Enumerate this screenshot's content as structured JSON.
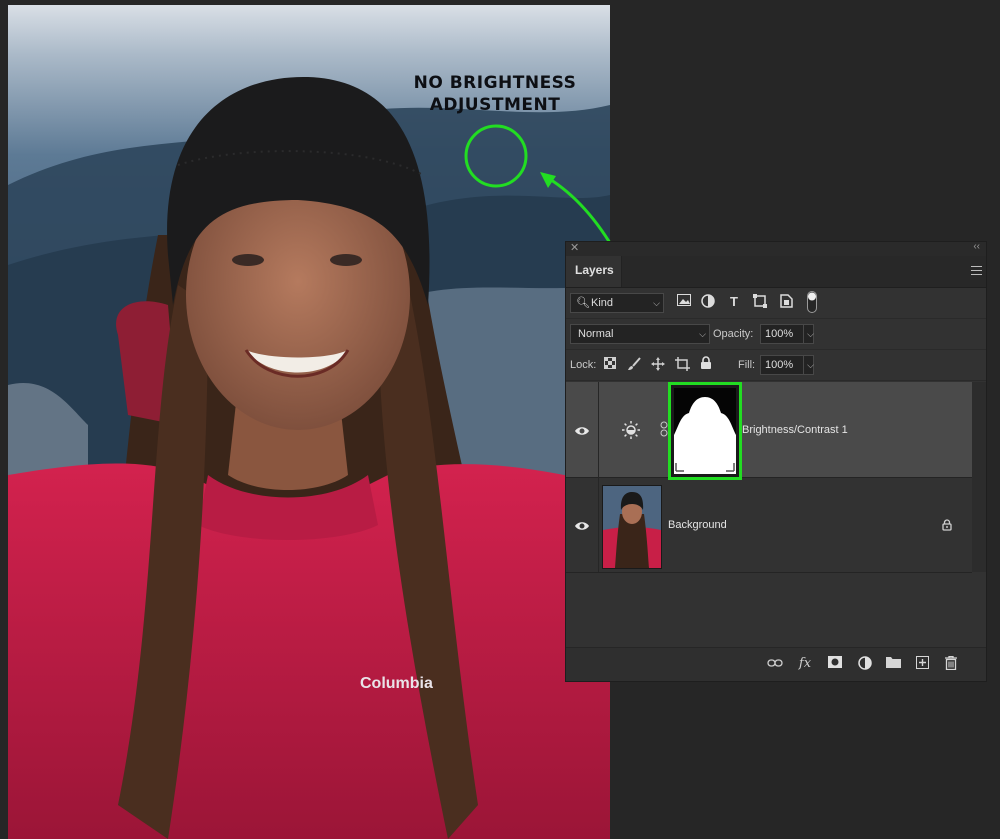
{
  "annotation": {
    "line1": "NO BRIGHTNESS",
    "line2": "ADJUSTMENT",
    "accent_color": "#22dd22"
  },
  "photo": {
    "jacket_logo": "Columbia"
  },
  "panel": {
    "tab_title": "Layers",
    "filter": {
      "label": "Kind"
    },
    "blend_mode": "Normal",
    "opacity_label": "Opacity:",
    "opacity_value": "100%",
    "lock_label": "Lock:",
    "fill_label": "Fill:",
    "fill_value": "100%",
    "layers": [
      {
        "name": "Brightness/Contrast 1",
        "type": "adjustment",
        "selected": true,
        "visible": true
      },
      {
        "name": "Background",
        "type": "image",
        "selected": false,
        "visible": true,
        "locked": true
      }
    ],
    "icons": {
      "filter": [
        "image-filter-icon",
        "adjustment-filter-icon",
        "type-filter-icon",
        "shape-filter-icon",
        "smart-object-filter-icon",
        "filter-toggle-icon"
      ],
      "lock": [
        "lock-transparent-icon",
        "lock-paint-icon",
        "lock-position-icon",
        "lock-artboard-icon",
        "lock-all-icon"
      ],
      "bottom": [
        "link-layers-icon",
        "layer-style-icon",
        "add-mask-icon",
        "new-adjustment-icon",
        "new-group-icon",
        "new-layer-icon",
        "delete-layer-icon"
      ]
    }
  }
}
